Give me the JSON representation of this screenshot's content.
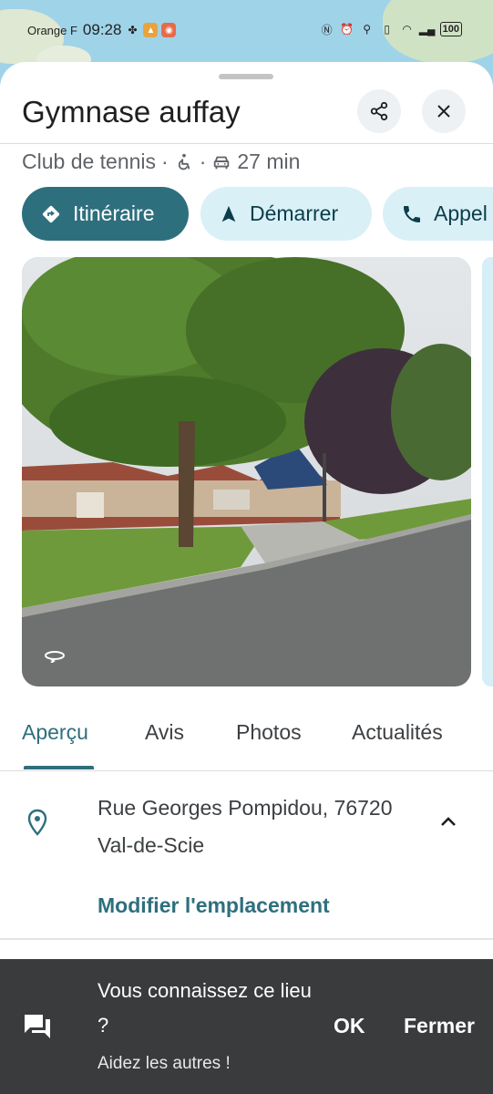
{
  "status_bar": {
    "carrier": "Orange F",
    "time": "09:28",
    "battery": "100"
  },
  "place": {
    "name": "Gymnase auffay",
    "category": "Club de tennis",
    "separator": "·",
    "drive_time": "27 min"
  },
  "actions": {
    "directions": "Itinéraire",
    "start": "Démarrer",
    "call": "Appel"
  },
  "tabs": [
    {
      "label": "Aperçu",
      "active": true
    },
    {
      "label": "Avis",
      "active": false
    },
    {
      "label": "Photos",
      "active": false
    },
    {
      "label": "Actualités",
      "active": false
    }
  ],
  "address": {
    "line1": "Rue Georges Pompidou, 76720",
    "line2": "Val-de-Scie",
    "edit_link": "Modifier l'emplacement"
  },
  "snackbar": {
    "title": "Vous connaissez ce lieu ?",
    "subtitle": "Aidez les autres !",
    "ok": "OK",
    "close": "Fermer"
  },
  "colors": {
    "accent": "#2e6f7e",
    "chip_bg": "#d9f0f7",
    "snackbar_bg": "#3a3b3d"
  }
}
